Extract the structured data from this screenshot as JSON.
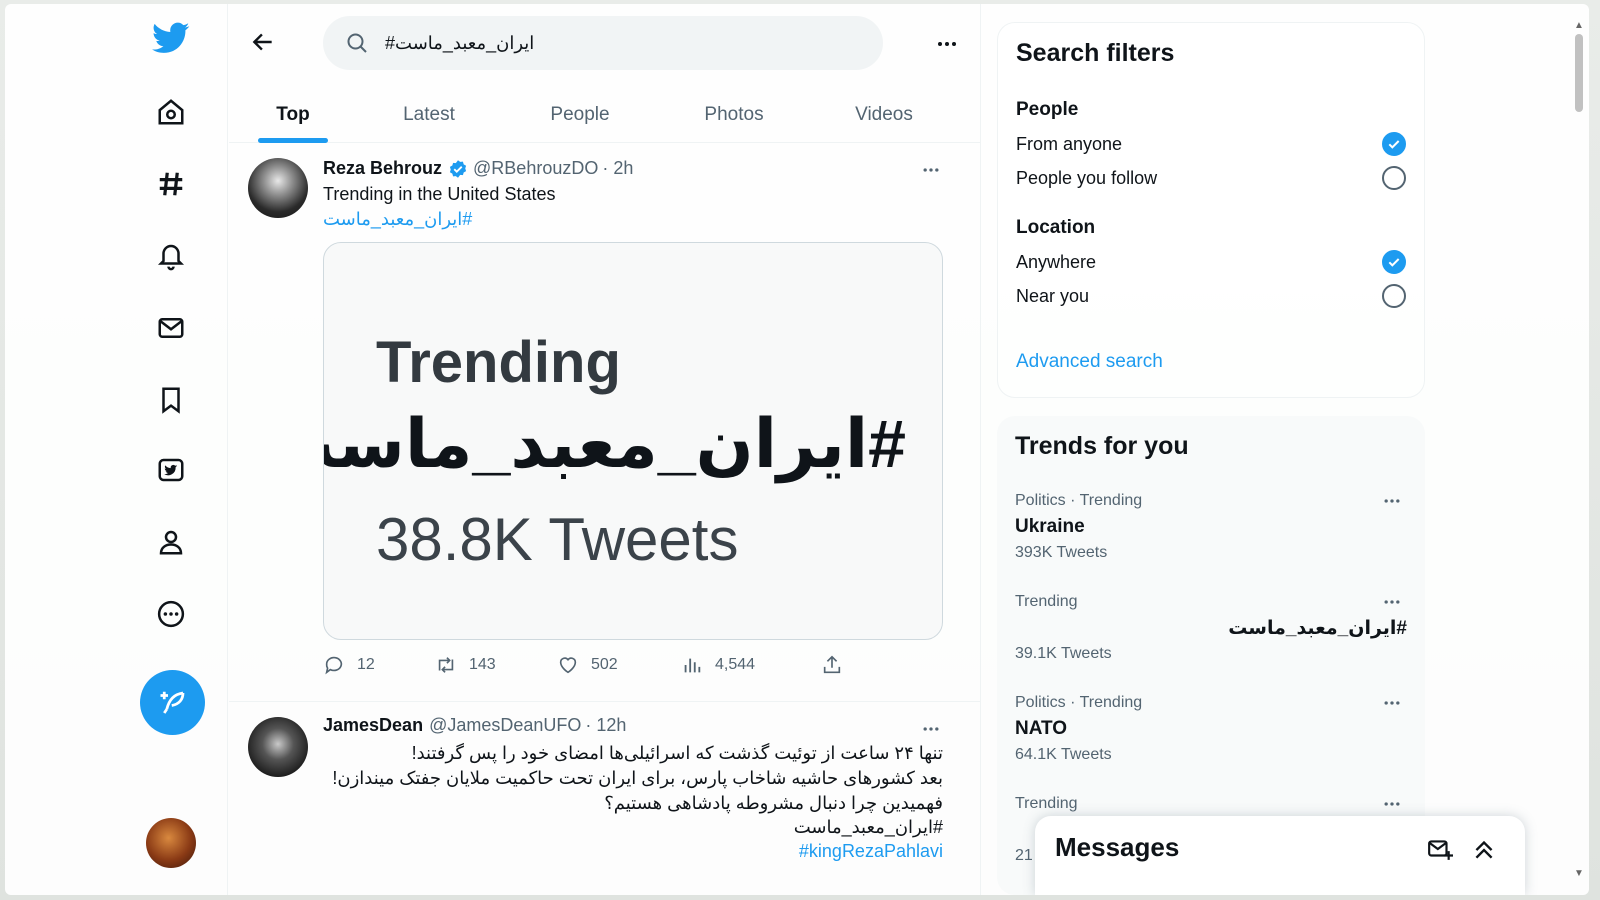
{
  "search": {
    "query": "#ایران_معبد_ماست"
  },
  "tabs": [
    {
      "label": "Top"
    },
    {
      "label": "Latest"
    },
    {
      "label": "People"
    },
    {
      "label": "Photos"
    },
    {
      "label": "Videos"
    }
  ],
  "tweets": [
    {
      "name": "Reza Behrouz",
      "handle": "@RBehrouzDO",
      "time": "· 2h",
      "text": "Trending in the United States",
      "hashtag": "#ایران_معبد_ماست",
      "card": {
        "title": "Trending",
        "hashtag": "#ایران_معبد_ماست",
        "count": "38.8K Tweets"
      },
      "replies": "12",
      "retweets": "143",
      "likes": "502",
      "views": "4,544"
    },
    {
      "name": "JamesDean",
      "handle": "@JamesDeanUFO",
      "time": "· 12h",
      "lines": [
        "تنها ۲۴ ساعت از توئیت گذشت که اسرائیلی‌ها امضای خود را پس گرفتند!",
        "بعد کشورهای حاشیه شاخاب پارس، برای ایران تحت حاکمیت ملایان جفتک میندازن!",
        "فهمیدین چرا دنبال مشروطه پادشاهی هستیم؟"
      ],
      "hashtags": [
        "#ایران_معبد_ماست",
        "#kingRezaPahlavi"
      ]
    }
  ],
  "filters": {
    "title": "Search filters",
    "people_label": "People",
    "from_anyone": "From anyone",
    "people_you_follow": "People you follow",
    "location_label": "Location",
    "anywhere": "Anywhere",
    "near_you": "Near you",
    "advanced": "Advanced search",
    "selected_people": "From anyone",
    "selected_location": "Anywhere"
  },
  "trends": {
    "title": "Trends for you",
    "items": [
      {
        "meta": "Politics · Trending",
        "name": "Ukraine",
        "count": "393K Tweets"
      },
      {
        "meta": "Trending",
        "name": "#ایران_معبد_ماست",
        "count": "39.1K Tweets"
      },
      {
        "meta": "Politics · Trending",
        "name": "NATO",
        "count": "64.1K Tweets"
      },
      {
        "meta": "Trending",
        "name": "",
        "count": "21"
      }
    ]
  },
  "messages": {
    "title": "Messages"
  },
  "colors": {
    "accent": "#1d9bf0",
    "text": "#0f1419",
    "muted": "#536471"
  },
  "icons": [
    "twitter-logo-icon",
    "home-icon",
    "explore-hashtag-icon",
    "bell-icon",
    "mail-icon",
    "bookmark-icon",
    "twitter-blue-icon",
    "profile-icon",
    "more-circle-icon",
    "compose-icon",
    "back-arrow-icon",
    "search-icon",
    "more-horizontal-icon",
    "verified-badge-icon",
    "reply-icon",
    "retweet-icon",
    "like-icon",
    "views-icon",
    "share-icon",
    "new-message-icon",
    "chevron-up-double-icon"
  ]
}
